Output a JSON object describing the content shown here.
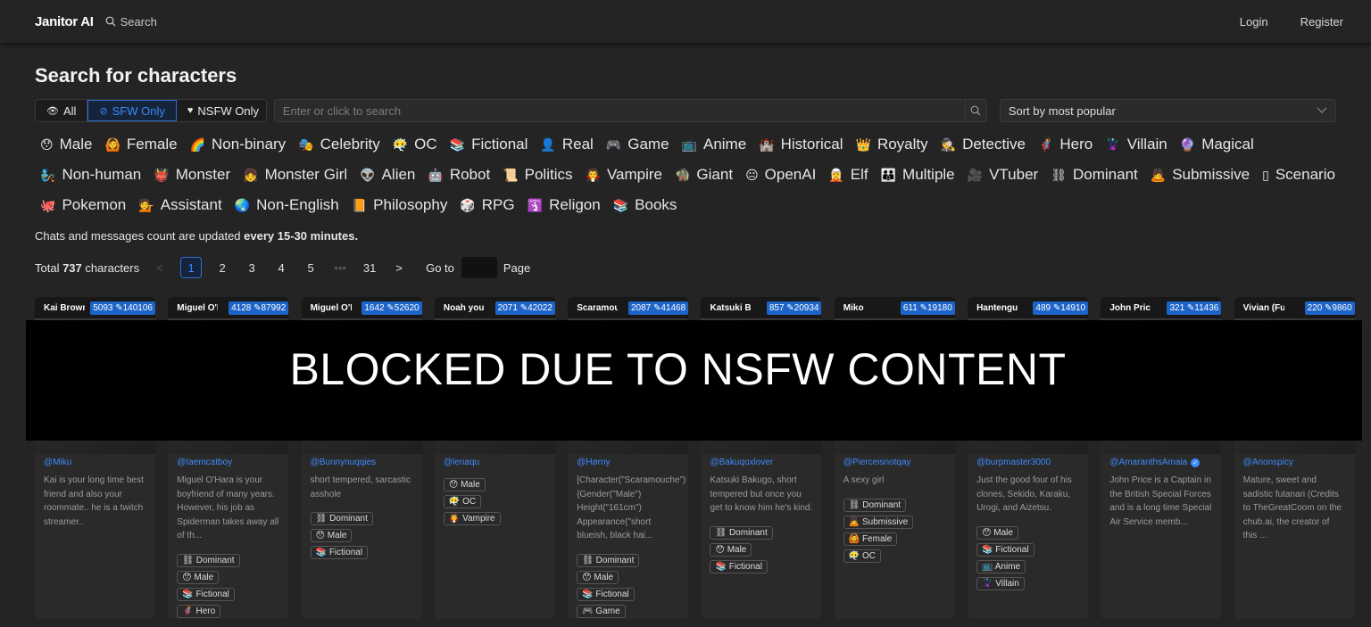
{
  "header": {
    "brand": "Janitor AI",
    "search_label": "Search",
    "login": "Login",
    "register": "Register"
  },
  "page": {
    "title": "Search for characters"
  },
  "filters": {
    "all": "All",
    "sfw": "SFW Only",
    "nsfw": "NSFW Only",
    "active": "sfw"
  },
  "search": {
    "placeholder": "Enter or click to search"
  },
  "sort": {
    "value": "Sort by most popular"
  },
  "tags": [
    {
      "emoji": "😯",
      "label": "Male"
    },
    {
      "emoji": "🙆",
      "label": "Female"
    },
    {
      "emoji": "🌈",
      "label": "Non-binary"
    },
    {
      "emoji": "🎭",
      "label": "Celebrity"
    },
    {
      "emoji": "😶‍🌫️",
      "label": "OC"
    },
    {
      "emoji": "📚",
      "label": "Fictional"
    },
    {
      "emoji": "👤",
      "label": "Real"
    },
    {
      "emoji": "🎮",
      "label": "Game"
    },
    {
      "emoji": "📺",
      "label": "Anime"
    },
    {
      "emoji": "🏰",
      "label": "Historical"
    },
    {
      "emoji": "👑",
      "label": "Royalty"
    },
    {
      "emoji": "🕵️",
      "label": "Detective"
    },
    {
      "emoji": "🦸",
      "label": "Hero"
    },
    {
      "emoji": "🦹",
      "label": "Villain"
    },
    {
      "emoji": "🔮",
      "label": "Magical"
    },
    {
      "emoji": "🧞",
      "label": "Non-human"
    },
    {
      "emoji": "👹",
      "label": "Monster"
    },
    {
      "emoji": "👧",
      "label": "Monster Girl"
    },
    {
      "emoji": "👽",
      "label": "Alien"
    },
    {
      "emoji": "🤖",
      "label": "Robot"
    },
    {
      "emoji": "📜",
      "label": "Politics"
    },
    {
      "emoji": "🧛",
      "label": "Vampire"
    },
    {
      "emoji": "🧌",
      "label": "Giant"
    },
    {
      "emoji": "😐",
      "label": "OpenAI"
    },
    {
      "emoji": "🧝",
      "label": "Elf"
    },
    {
      "emoji": "👪",
      "label": "Multiple"
    },
    {
      "emoji": "🎥",
      "label": "VTuber"
    },
    {
      "emoji": "⛓",
      "label": "Dominant"
    },
    {
      "emoji": "🙇",
      "label": "Submissive"
    },
    {
      "emoji": "▯",
      "label": "Scenario"
    },
    {
      "emoji": "🐙",
      "label": "Pokemon"
    },
    {
      "emoji": "💁",
      "label": "Assistant"
    },
    {
      "emoji": "🌏",
      "label": "Non-English"
    },
    {
      "emoji": "📙",
      "label": "Philosophy"
    },
    {
      "emoji": "🎲",
      "label": "RPG"
    },
    {
      "emoji": "🛐",
      "label": "Religon"
    },
    {
      "emoji": "📚",
      "label": "Books"
    }
  ],
  "note": {
    "prefix": "Chats and messages count are updated ",
    "bold": "every 15-30 minutes."
  },
  "pagination": {
    "total_prefix": "Total ",
    "total_count": "737",
    "total_suffix": " characters",
    "prev": "<",
    "pages": [
      "1",
      "2",
      "3",
      "4",
      "5"
    ],
    "ellipsis": "•••",
    "last": "31",
    "next": ">",
    "goto": "Go to",
    "page": "Page",
    "current": "1"
  },
  "cards": [
    {
      "name": "Kai Brown",
      "stat": "5093 ✎140106",
      "author": "@Miku",
      "verified": false,
      "desc": "Kai is your long time best friend and also your roommate.. he is a twitch streamer..",
      "chips": []
    },
    {
      "name": "Miguel O'Hara",
      "stat": "4128 ✎87992",
      "author": "@taemcatboy",
      "verified": false,
      "desc": "Miguel O'Hara is your boyfriend of many years. However, his job as Spiderman takes away all of th...",
      "chips": [
        "⛓ Dominant",
        "😯 Male",
        "📚 Fictional",
        "🦸 Hero"
      ]
    },
    {
      "name": "Miguel O'Hara",
      "stat": "1642 ✎52620",
      "author": "@Bunnynuqqies",
      "verified": false,
      "desc": "short tempered, sarcastic asshole",
      "chips": [
        "⛓ Dominant",
        "😯 Male",
        "📚 Fictional"
      ]
    },
    {
      "name": "Noah your",
      "stat": "2071 ✎42022",
      "author": "@lenaqu",
      "verified": false,
      "desc": "",
      "chips": [
        "😯 Male",
        "😶‍🌫️ OC",
        "🧛 Vampire"
      ]
    },
    {
      "name": "Scaramouche",
      "stat": "2087 ✎41468",
      "author": "@Hørny",
      "verified": false,
      "desc": "[Character(\"Scaramouche\") {Gender(\"Male\") Height(\"161cm\") Appearance(\"short blueish, black hai...",
      "chips": [
        "⛓ Dominant",
        "😯 Male",
        "📚 Fictional",
        "🎮 Game"
      ]
    },
    {
      "name": "Katsuki Bakugo",
      "stat": "857 ✎20934",
      "author": "@Bakuqoxlover",
      "verified": false,
      "desc": "Katsuki Bakugo, short tempered but once you get to know him he's kind.",
      "chips": [
        "⛓ Dominant",
        "😯 Male",
        "📚 Fictional"
      ]
    },
    {
      "name": "Miko",
      "stat": "611 ✎19180",
      "author": "@Pierceisnotqay",
      "verified": false,
      "desc": "A sexy girl",
      "chips": [
        "⛓ Dominant",
        "🙇 Submissive",
        "🙆 Female",
        "😶‍🌫️ OC"
      ]
    },
    {
      "name": "Hantengu C",
      "stat": "489 ✎14910",
      "author": "@burpmaster3000",
      "verified": false,
      "desc": "Just the good four of his clones, Sekido, Karaku, Urogi, and Aizetsu.",
      "chips": [
        "😯 Male",
        "📚 Fictional",
        "📺 Anime",
        "🦹 Villain"
      ]
    },
    {
      "name": "John Price",
      "stat": "321 ✎11436",
      "author": "@AmaranthsAmaia",
      "verified": true,
      "desc": "John Price is a Captain in the British Special Forces and is a long time Special Air Service memb...",
      "chips": []
    },
    {
      "name": "Vivian (Futan",
      "stat": "220 ✎9860",
      "author": "@Anonspicy",
      "verified": false,
      "desc": "Mature, sweet and sadistic futanari (Credits to TheGreatCoom on the chub.ai, the creator of this ...",
      "chips": []
    }
  ],
  "overlay": {
    "text": "BLOCKED DUE TO NSFW CONTENT"
  }
}
